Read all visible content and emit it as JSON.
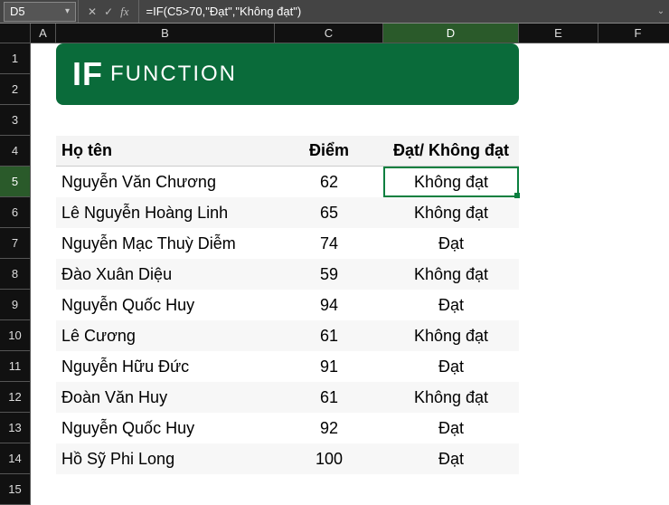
{
  "formula_bar": {
    "cell_ref": "D5",
    "cancel_icon": "✕",
    "confirm_icon": "✓",
    "fx_label": "fx",
    "formula": "=IF(C5>70,\"Đạt\",\"Không đạt\")",
    "expand_icon": "⌄"
  },
  "columns": [
    "A",
    "B",
    "C",
    "D",
    "E",
    "F"
  ],
  "rows": [
    "1",
    "2",
    "3",
    "4",
    "5",
    "6",
    "7",
    "8",
    "9",
    "10",
    "11",
    "12",
    "13",
    "14",
    "15"
  ],
  "active_col": "D",
  "active_row": "5",
  "title": {
    "if": "IF",
    "function": "FUNCTION"
  },
  "headers": {
    "name": "Họ tên",
    "score": "Điểm",
    "status": "Đạt/ Không đạt"
  },
  "chart_data": {
    "type": "table",
    "columns": [
      "Họ tên",
      "Điểm",
      "Đạt/ Không đạt"
    ],
    "rows": [
      {
        "name": "Nguyễn Văn Chương",
        "score": 62,
        "status": "Không đạt"
      },
      {
        "name": "Lê Nguyễn Hoàng Linh",
        "score": 65,
        "status": "Không đạt"
      },
      {
        "name": "Nguyễn Mạc Thuỳ Diễm",
        "score": 74,
        "status": "Đạt"
      },
      {
        "name": "Đào Xuân Diệu",
        "score": 59,
        "status": "Không đạt"
      },
      {
        "name": "Nguyễn Quốc Huy",
        "score": 94,
        "status": "Đạt"
      },
      {
        "name": "Lê Cương",
        "score": 61,
        "status": "Không đạt"
      },
      {
        "name": "Nguyễn Hữu Đức",
        "score": 91,
        "status": "Đạt"
      },
      {
        "name": "Đoàn Văn Huy",
        "score": 61,
        "status": "Không đạt"
      },
      {
        "name": "Nguyễn Quốc Huy",
        "score": 92,
        "status": "Đạt"
      },
      {
        "name": "Hồ Sỹ Phi Long",
        "score": 100,
        "status": "Đạt"
      }
    ]
  }
}
